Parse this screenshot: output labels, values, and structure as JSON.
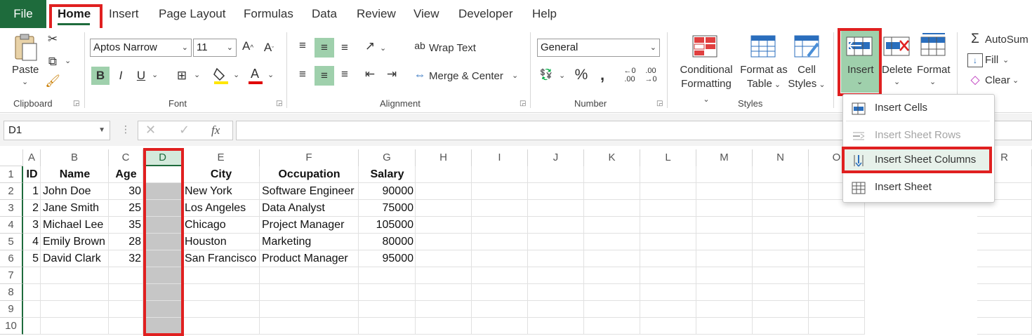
{
  "tabs": {
    "file": "File",
    "home": "Home",
    "insert": "Insert",
    "page_layout": "Page Layout",
    "formulas": "Formulas",
    "data": "Data",
    "review": "Review",
    "view": "View",
    "developer": "Developer",
    "help": "Help"
  },
  "ribbon": {
    "clipboard": {
      "paste": "Paste",
      "label": "Clipboard"
    },
    "font": {
      "name": "Aptos Narrow",
      "size": "11",
      "bold": "B",
      "italic": "I",
      "underline": "U",
      "label": "Font"
    },
    "alignment": {
      "wrap_text": "Wrap Text",
      "merge_center": "Merge & Center",
      "label": "Alignment"
    },
    "number": {
      "format": "General",
      "percent": "%",
      "comma": "❩",
      "inc_decimal": ".00",
      "dec_decimal": ".00",
      "label": "Number"
    },
    "styles": {
      "conditional_1": "Conditional",
      "conditional_2": "Formatting",
      "format_table_1": "Format as",
      "format_table_2": "Table",
      "cell_styles_1": "Cell",
      "cell_styles_2": "Styles",
      "label": "Styles"
    },
    "cells": {
      "insert": "Insert",
      "delete": "Delete",
      "format": "Format"
    },
    "editing": {
      "autosum": "AutoSum",
      "fill": "Fill",
      "clear": "Clear"
    }
  },
  "formula_bar": {
    "name_box": "D1",
    "fx": "fx",
    "formula": ""
  },
  "columns": [
    "A",
    "B",
    "C",
    "D",
    "E",
    "F",
    "G",
    "H",
    "I",
    "J",
    "K",
    "L",
    "M",
    "N",
    "O",
    "R"
  ],
  "rows": [
    "1",
    "2",
    "3",
    "4",
    "5",
    "6",
    "7",
    "8",
    "9",
    "10"
  ],
  "table": {
    "headers": [
      "ID",
      "Name",
      "Age",
      "City",
      "Occupation",
      "Salary"
    ],
    "data": [
      [
        "1",
        "John Doe",
        "30",
        "New York",
        "Software Engineer",
        "90000"
      ],
      [
        "2",
        "Jane Smith",
        "25",
        "Los Angeles",
        "Data Analyst",
        "75000"
      ],
      [
        "3",
        "Michael Lee",
        "35",
        "Chicago",
        "Project Manager",
        "105000"
      ],
      [
        "4",
        "Emily Brown",
        "28",
        "Houston",
        "Marketing",
        "80000"
      ],
      [
        "5",
        "David Clark",
        "32",
        "San Francisco",
        "Product Manager",
        "95000"
      ]
    ]
  },
  "insert_menu": {
    "insert_cells": "Insert Cells",
    "insert_rows": "Insert Sheet Rows",
    "insert_columns": "Insert Sheet Columns",
    "insert_sheet": "Insert Sheet"
  },
  "colors": {
    "excel_green": "#1e6b3c",
    "highlight": "#e02020",
    "selected_col": "#c6c6c6"
  }
}
